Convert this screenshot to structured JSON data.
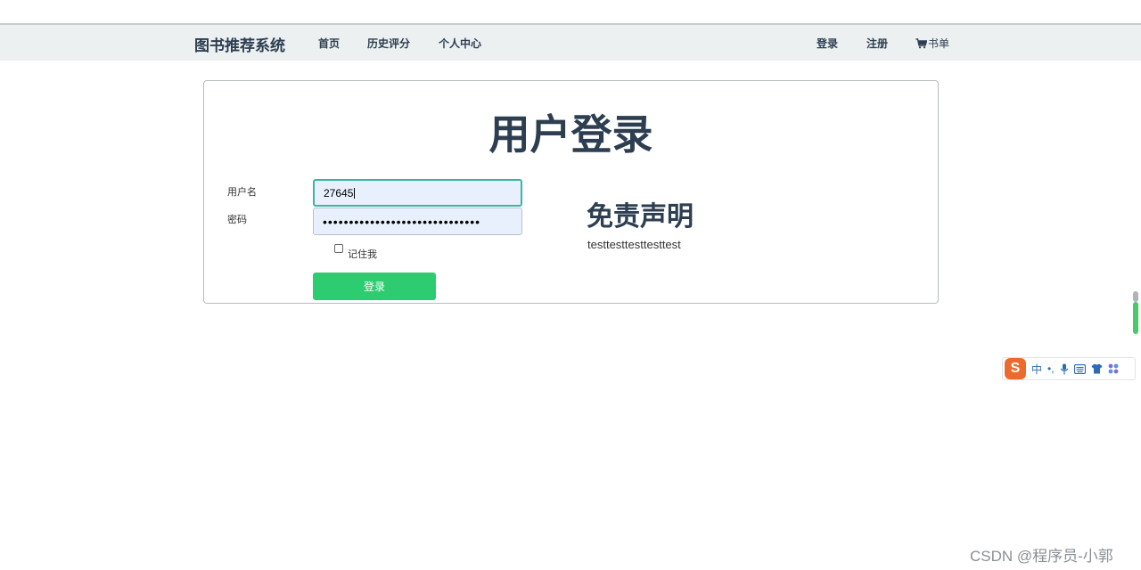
{
  "navbar": {
    "brand": "图书推荐系统",
    "links": {
      "home": "首页",
      "history": "历史评分",
      "profile": "个人中心",
      "login": "登录",
      "register": "注册",
      "cart": "书单"
    }
  },
  "login_panel": {
    "title": "用户登录",
    "username_label": "用户名",
    "username_value": "27645",
    "password_label": "密码",
    "password_value": "••••••••••••••••••••••••••••••",
    "remember_label": "记住我",
    "remember_checked": false,
    "submit_label": "登录"
  },
  "disclaimer": {
    "title": "免责声明",
    "text": "testtesttesttesttest"
  },
  "ime_toolbar": {
    "logo": "S",
    "mode": "中",
    "punct": "•,",
    "icons": [
      "microphone-icon",
      "keyboard-icon",
      "shirt-icon",
      "grid-icon"
    ]
  },
  "watermark": "CSDN @程序员-小郭",
  "colors": {
    "navbar_bg": "#ecf0f1",
    "text_dark": "#2c3e50",
    "button_green": "#2ecc71",
    "input_focus_border": "#3cb6a0",
    "input_bg": "#e8f0fe"
  }
}
